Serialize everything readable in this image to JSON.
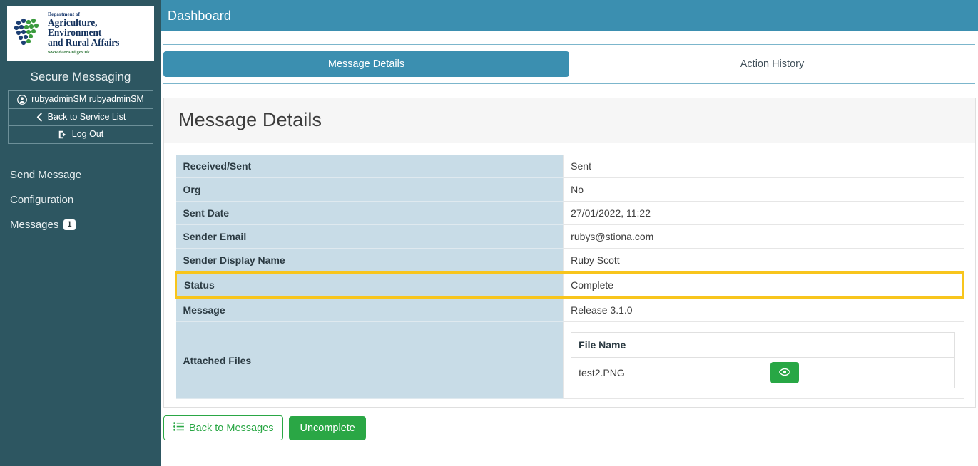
{
  "sidebar": {
    "logo": {
      "department_line": "Department of",
      "title_line1": "Agriculture, Environment",
      "title_line2": "and Rural Affairs",
      "url": "www.daera-ni.gov.uk"
    },
    "brand": "Secure Messaging",
    "user_buttons": [
      {
        "label": "rubyadminSM rubyadminSM",
        "icon": "user-circle-icon"
      },
      {
        "label": "Back to Service List",
        "icon": "chevron-left-icon"
      },
      {
        "label": "Log Out",
        "icon": "sign-out-icon"
      }
    ],
    "nav": [
      {
        "label": "Send Message",
        "badge": ""
      },
      {
        "label": "Configuration",
        "badge": ""
      },
      {
        "label": "Messages",
        "badge": "1"
      }
    ]
  },
  "header": {
    "title": "Dashboard"
  },
  "tabs": [
    {
      "label": "Message Details",
      "active": true
    },
    {
      "label": "Action History",
      "active": false
    }
  ],
  "card": {
    "title": "Message Details",
    "rows": [
      {
        "label": "Received/Sent",
        "value": "Sent",
        "highlight": false
      },
      {
        "label": "Org",
        "value": "No",
        "highlight": false
      },
      {
        "label": "Sent Date",
        "value": "27/01/2022, 11:22",
        "highlight": false
      },
      {
        "label": "Sender Email",
        "value": "rubys@stiona.com",
        "highlight": false
      },
      {
        "label": "Sender Display Name",
        "value": "Ruby Scott",
        "highlight": false
      },
      {
        "label": "Status",
        "value": "Complete",
        "highlight": true
      },
      {
        "label": "Message",
        "value": "Release 3.1.0",
        "highlight": false
      }
    ],
    "attached": {
      "label": "Attached Files",
      "column_headers": [
        "File Name",
        ""
      ],
      "files": [
        {
          "name": "test2.PNG",
          "action_icon": "eye-icon"
        }
      ]
    }
  },
  "footer": {
    "back_button": {
      "label": "Back to Messages",
      "icon": "list-icon"
    },
    "uncomplete_button": {
      "label": "Uncomplete"
    }
  },
  "colors": {
    "sidebar_bg": "#2d5661",
    "header_bg": "#3b8fb0",
    "label_cell_bg": "#c8dce7",
    "highlight_border": "#f8c51c",
    "green": "#28a745"
  }
}
